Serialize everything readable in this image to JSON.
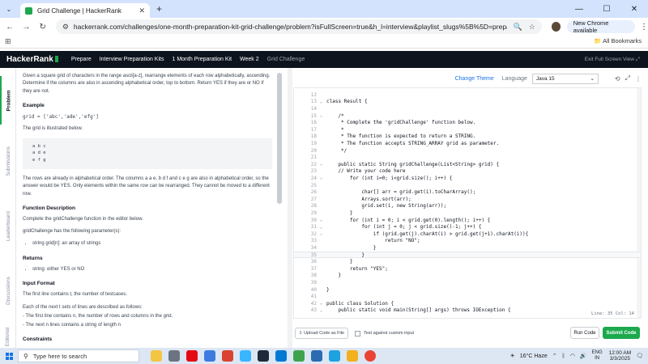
{
  "browser": {
    "tab_title": "Grid Challenge | HackerRank",
    "tab_close": "✕",
    "new_tab": "+",
    "url": "hackerrank.com/challenges/one-month-preparation-kit-grid-challenge/problem?isFullScreen=true&h_l=interview&playlist_slugs%5B%5D=preparation-kits&playlist_s...",
    "new_chrome": "New Chrome available",
    "all_bookmarks": "All Bookmarks"
  },
  "hr_header": {
    "logo": "HackerRank",
    "crumbs": [
      "Prepare",
      "Interview Preparation Kits",
      "1 Month Preparation Kit",
      "Week 2",
      "Grid Challenge"
    ],
    "exit": "Exit Full Screen View"
  },
  "vtabs": [
    "Problem",
    "Submissions",
    "Leaderboard",
    "Discussions",
    "Editorial"
  ],
  "problem": {
    "intro": "Given a square grid of characters in the range ascii[a-z], rearrange elements of each row alphabetically, ascending. Determine if the columns are also in ascending alphabetical order, top to bottom. Return YES if they are or NO if they are not.",
    "example_h": "Example",
    "example_grid": "grid = ['abc','ade','efg']",
    "illustrated": "The grid is illustrated below.",
    "grid_rows": [
      "a b c",
      "a d e",
      "e f g"
    ],
    "explanation": "The rows are already in alphabetical order. The columns a a e, b d f and c e g are also in alphabetical order, so the answer would be YES. Only elements within the same row can be rearranged. They cannot be moved to a different row.",
    "func_h": "Function Description",
    "func_p1": "Complete the gridChallenge function in the editor below.",
    "func_p2": "gridChallenge has the following parameter(s):",
    "param": "string grid[n]: an array of strings",
    "returns_h": "Returns",
    "returns": "string: either YES or NO",
    "input_h": "Input Format",
    "input_p1": "The first line contains t, the number of testcases.",
    "input_p2": "Each of the next t sets of lines are described as follows:",
    "input_p3": "- The first line contains n, the number of rows and columns in the grid.",
    "input_p4": "- The next n lines contains a string of length n",
    "constraints_h": "Constraints"
  },
  "editor": {
    "change_theme": "Change Theme",
    "language_label": "Language",
    "language": "Java 15",
    "status": "Line: 35 Col: 14",
    "lines": [
      {
        "n": "12",
        "t": ""
      },
      {
        "n": "13",
        "t": "class Result {",
        "f": "v"
      },
      {
        "n": "14",
        "t": ""
      },
      {
        "n": "15",
        "t": "    /*",
        "f": "v",
        "c": "cm"
      },
      {
        "n": "16",
        "t": "     * Complete the 'gridChallenge' function below.",
        "c": "cm"
      },
      {
        "n": "17",
        "t": "     *",
        "c": "cm"
      },
      {
        "n": "18",
        "t": "     * The function is expected to return a STRING.",
        "c": "cm"
      },
      {
        "n": "19",
        "t": "     * The function accepts STRING_ARRAY grid as parameter.",
        "c": "cm"
      },
      {
        "n": "20",
        "t": "     */",
        "c": "cm"
      },
      {
        "n": "21",
        "t": ""
      },
      {
        "n": "22",
        "t": "    public static String gridChallenge(List<String> grid) {",
        "f": "v"
      },
      {
        "n": "23",
        "t": "    // Write your code here",
        "c": "cm"
      },
      {
        "n": "24",
        "t": "        for (int i=0; i<grid.size(); i++) {",
        "f": "v"
      },
      {
        "n": "25",
        "t": ""
      },
      {
        "n": "26",
        "t": "            char[] arr = grid.get(i).toCharArray();"
      },
      {
        "n": "27",
        "t": "            Arrays.sort(arr);"
      },
      {
        "n": "28",
        "t": "            grid.set(i, new String(arr));"
      },
      {
        "n": "29",
        "t": "        }"
      },
      {
        "n": "30",
        "t": "        for (int i = 0; i < grid.get(0).length(); i++) {",
        "f": "v"
      },
      {
        "n": "31",
        "t": "            for (int j = 0; j < grid.size()-1; j++) {",
        "f": "v"
      },
      {
        "n": "32",
        "t": "                if (grid.get(j).charAt(i) > grid.get(j+1).charAt(i)){",
        "f": "v"
      },
      {
        "n": "33",
        "t": "                    return \"NO\";"
      },
      {
        "n": "34",
        "t": "                }"
      },
      {
        "n": "35",
        "t": "            }",
        "a": true
      },
      {
        "n": "36",
        "t": "        }"
      },
      {
        "n": "37",
        "t": "        return \"YES\";"
      },
      {
        "n": "38",
        "t": "    }"
      },
      {
        "n": "39",
        "t": ""
      },
      {
        "n": "40",
        "t": "}"
      },
      {
        "n": "41",
        "t": ""
      },
      {
        "n": "42",
        "t": "public class Solution {",
        "f": "v"
      },
      {
        "n": "43",
        "t": "    public static void main(String[] args) throws IOException {",
        "f": "v"
      }
    ]
  },
  "bottom": {
    "upload": "Upload Code as File",
    "custom_input": "Test against custom input",
    "run": "Run Code",
    "submit": "Submit Code"
  },
  "taskbar": {
    "search": "Type here to search",
    "weather": "16°C Haze",
    "lang1": "ENG",
    "lang2": "IN",
    "time": "12:00 AM",
    "date": "3/3/2025"
  }
}
